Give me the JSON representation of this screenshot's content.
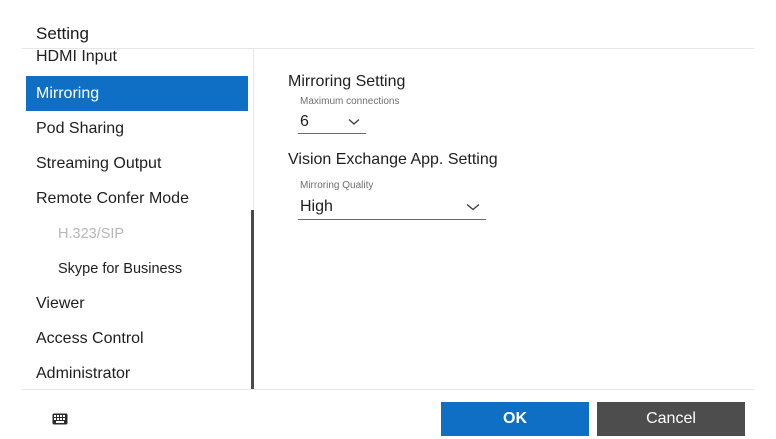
{
  "dialog": {
    "title": "Setting"
  },
  "sidebar": {
    "items": [
      {
        "label": "HDMI Input",
        "selected": false,
        "disabled": false,
        "sub": false
      },
      {
        "label": "Mirroring",
        "selected": true,
        "disabled": false,
        "sub": false
      },
      {
        "label": "Pod Sharing",
        "selected": false,
        "disabled": false,
        "sub": false
      },
      {
        "label": "Streaming Output",
        "selected": false,
        "disabled": false,
        "sub": false
      },
      {
        "label": "Remote Confer Mode",
        "selected": false,
        "disabled": false,
        "sub": false
      },
      {
        "label": "H.323/SIP",
        "selected": false,
        "disabled": true,
        "sub": true
      },
      {
        "label": "Skype for Business",
        "selected": false,
        "disabled": false,
        "sub": true
      },
      {
        "label": "Viewer",
        "selected": false,
        "disabled": false,
        "sub": false
      },
      {
        "label": "Access Control",
        "selected": false,
        "disabled": false,
        "sub": false
      },
      {
        "label": "Administrator",
        "selected": false,
        "disabled": false,
        "sub": false
      }
    ]
  },
  "main": {
    "mirroring_setting": {
      "title": "Mirroring Setting",
      "max_connections_label": "Maximum connections",
      "max_connections_value": "6"
    },
    "vision_exchange": {
      "title": "Vision Exchange App. Setting",
      "quality_label": "Mirroring Quality",
      "quality_value": "High"
    }
  },
  "footer": {
    "ok_label": "OK",
    "cancel_label": "Cancel",
    "keyboard_icon": "keyboard-icon"
  },
  "colors": {
    "accent": "#0e6fc4",
    "cancel_bg": "#4d4d4d",
    "disabled_text": "#b6b6b6"
  }
}
